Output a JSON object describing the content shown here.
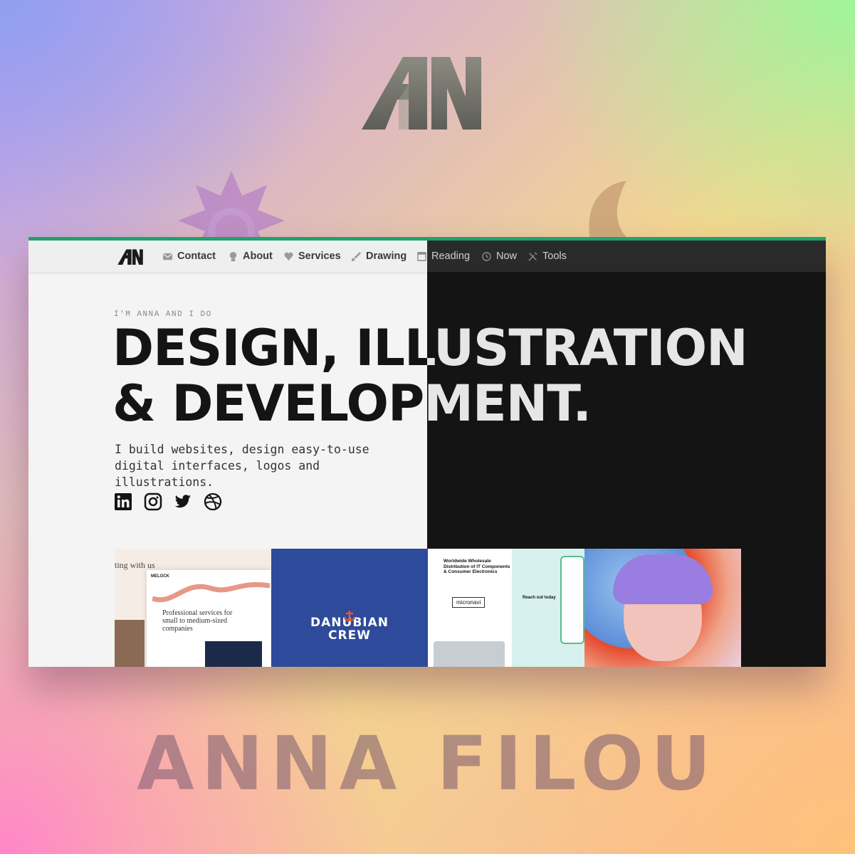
{
  "brand": {
    "name_footer": "ANNA FILOU",
    "accent": "#1ea36b"
  },
  "nav": {
    "items": [
      {
        "label": "Contact",
        "icon": "mail-icon"
      },
      {
        "label": "About",
        "icon": "person-icon"
      },
      {
        "label": "Services",
        "icon": "heart-hands-icon"
      },
      {
        "label": "Drawing",
        "icon": "brush-icon"
      },
      {
        "label": "Reading",
        "icon": "book-icon"
      },
      {
        "label": "Now",
        "icon": "history-icon"
      },
      {
        "label": "Tools",
        "icon": "tools-icon"
      }
    ]
  },
  "hero": {
    "eyebrow": "I'M ANNA AND I DO",
    "headline_line1": "DESIGN, ILLUSTRATION",
    "headline_line2": "& DEVELOPMENT.",
    "intro_line1": "I build websites, design easy-to-use",
    "intro_line2": "digital interfaces, logos and illustrations."
  },
  "socials": [
    "linkedin-icon",
    "instagram-icon",
    "twitter-icon",
    "dribbble-icon"
  ],
  "gallery": {
    "tile1": {
      "fragment": "ting with us",
      "brand": "MELOCK",
      "headline": "Professional services for small to medium-sized companies"
    },
    "tile2": {
      "line1": "DANUBIAN",
      "line2": "CREW"
    },
    "tile3": {
      "headline": "Worldwide Wholesale Distribution of IT Components & Consumer Electronics",
      "brand": "micronavi",
      "cta": "Reach out today"
    }
  }
}
